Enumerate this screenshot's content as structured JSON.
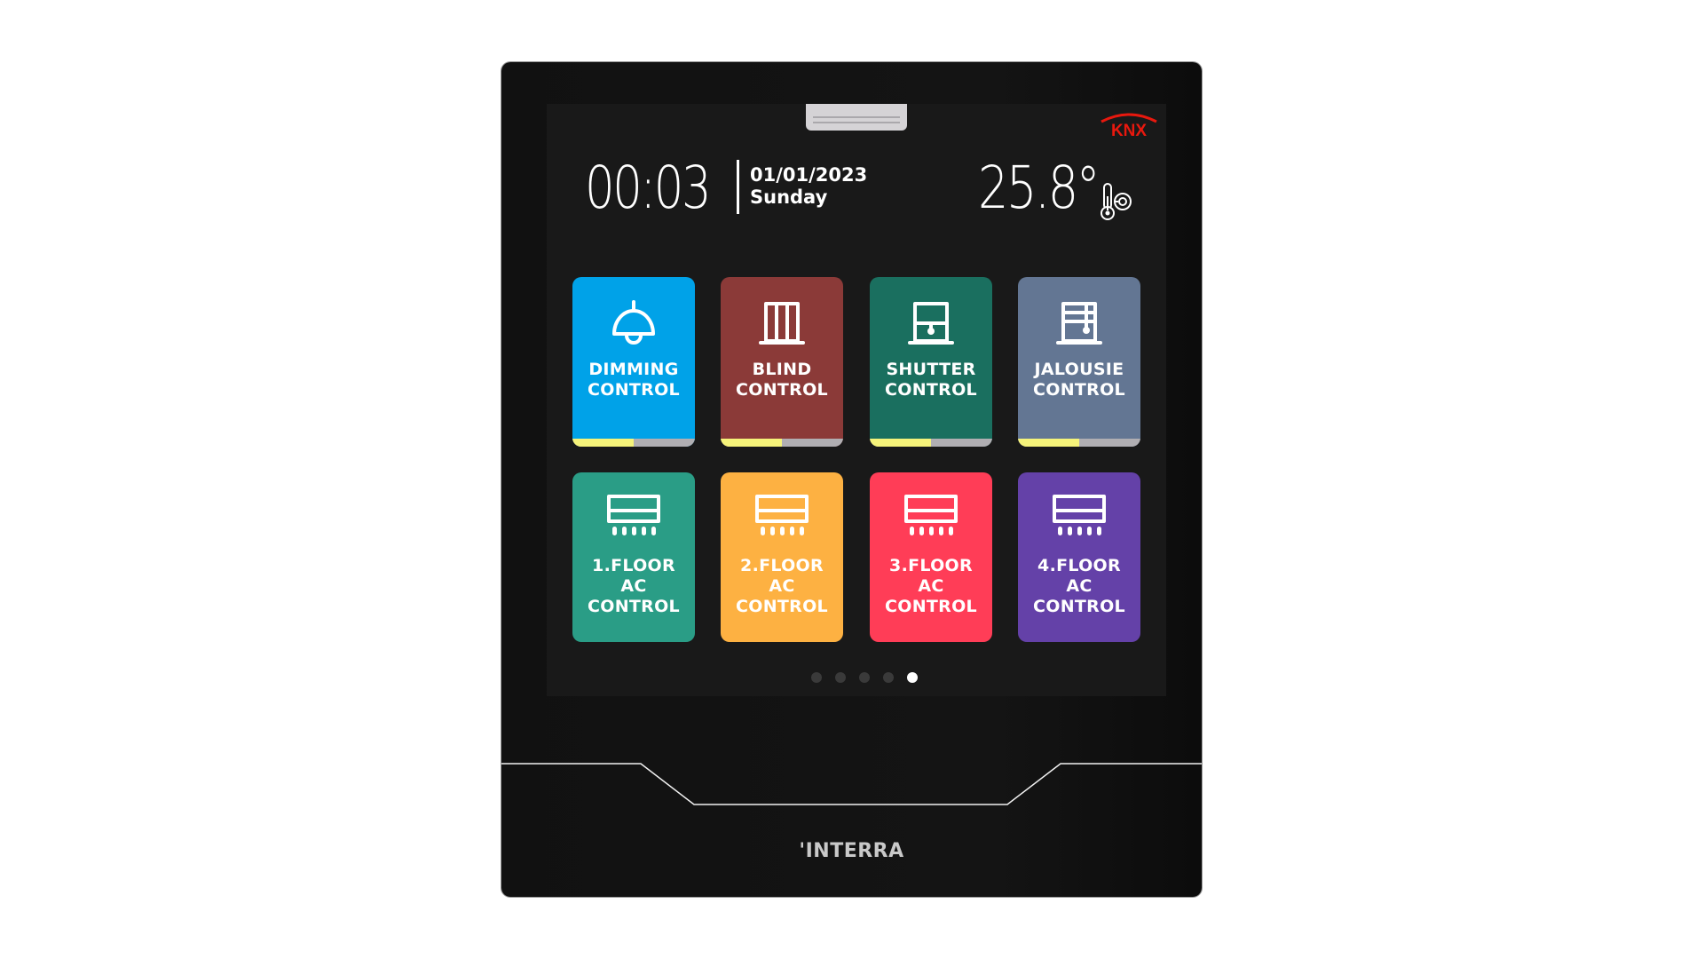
{
  "header": {
    "logo": "KNX",
    "time": "00:03",
    "date": "01/01/2023",
    "weekday": "Sunday",
    "temperature": "25.8°",
    "temperature_icon": "thermometer-icon"
  },
  "tiles": [
    {
      "label": "DIMMING\nCONTROL",
      "icon": "pendant-lamp-icon",
      "color": "#00a2e8",
      "progress": 0.5
    },
    {
      "label": "BLIND\nCONTROL",
      "icon": "blind-icon",
      "color": "#8b3a38",
      "progress": 0.5
    },
    {
      "label": "SHUTTER\nCONTROL",
      "icon": "shutter-icon",
      "color": "#1a6f5f",
      "progress": 0.5
    },
    {
      "label": "JALOUSIE\nCONTROL",
      "icon": "jalousie-icon",
      "color": "#637693",
      "progress": 0.5
    },
    {
      "label": "1.FLOOR\nAC\nCONTROL",
      "icon": "air-conditioner-icon",
      "color": "#2a9d86"
    },
    {
      "label": "2.FLOOR\nAC\nCONTROL",
      "icon": "air-conditioner-icon",
      "color": "#fdb142"
    },
    {
      "label": "3.FLOOR\nAC\nCONTROL",
      "icon": "air-conditioner-icon",
      "color": "#ff3d57"
    },
    {
      "label": "4.FLOOR\nAC\nCONTROL",
      "icon": "air-conditioner-icon",
      "color": "#6441a8"
    }
  ],
  "pagination": {
    "total": 5,
    "active": 5
  },
  "brand": "'INTERRA",
  "colors": {
    "knx_red": "#e8180e",
    "progress_fill": "#f5f37a",
    "progress_track": "#b0aeb2"
  }
}
